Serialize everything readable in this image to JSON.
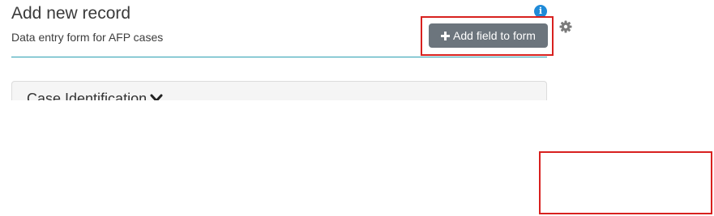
{
  "header": {
    "title": "Add new record",
    "subtitle": "Data entry form for AFP cases"
  },
  "toolbar": {
    "add_field_label": "Add field to form",
    "info_icon_glyph": "i",
    "icons": {
      "info": "info-icon",
      "settings": "gear-icon",
      "add": "plus-icon"
    }
  },
  "sections": [
    {
      "label": "Case Identification",
      "icon": "chevron-down-icon"
    }
  ],
  "colors": {
    "accent": "#2a9fb1",
    "button": "#6c757d",
    "info": "#1f8ad8",
    "highlight": "#d8211f"
  }
}
